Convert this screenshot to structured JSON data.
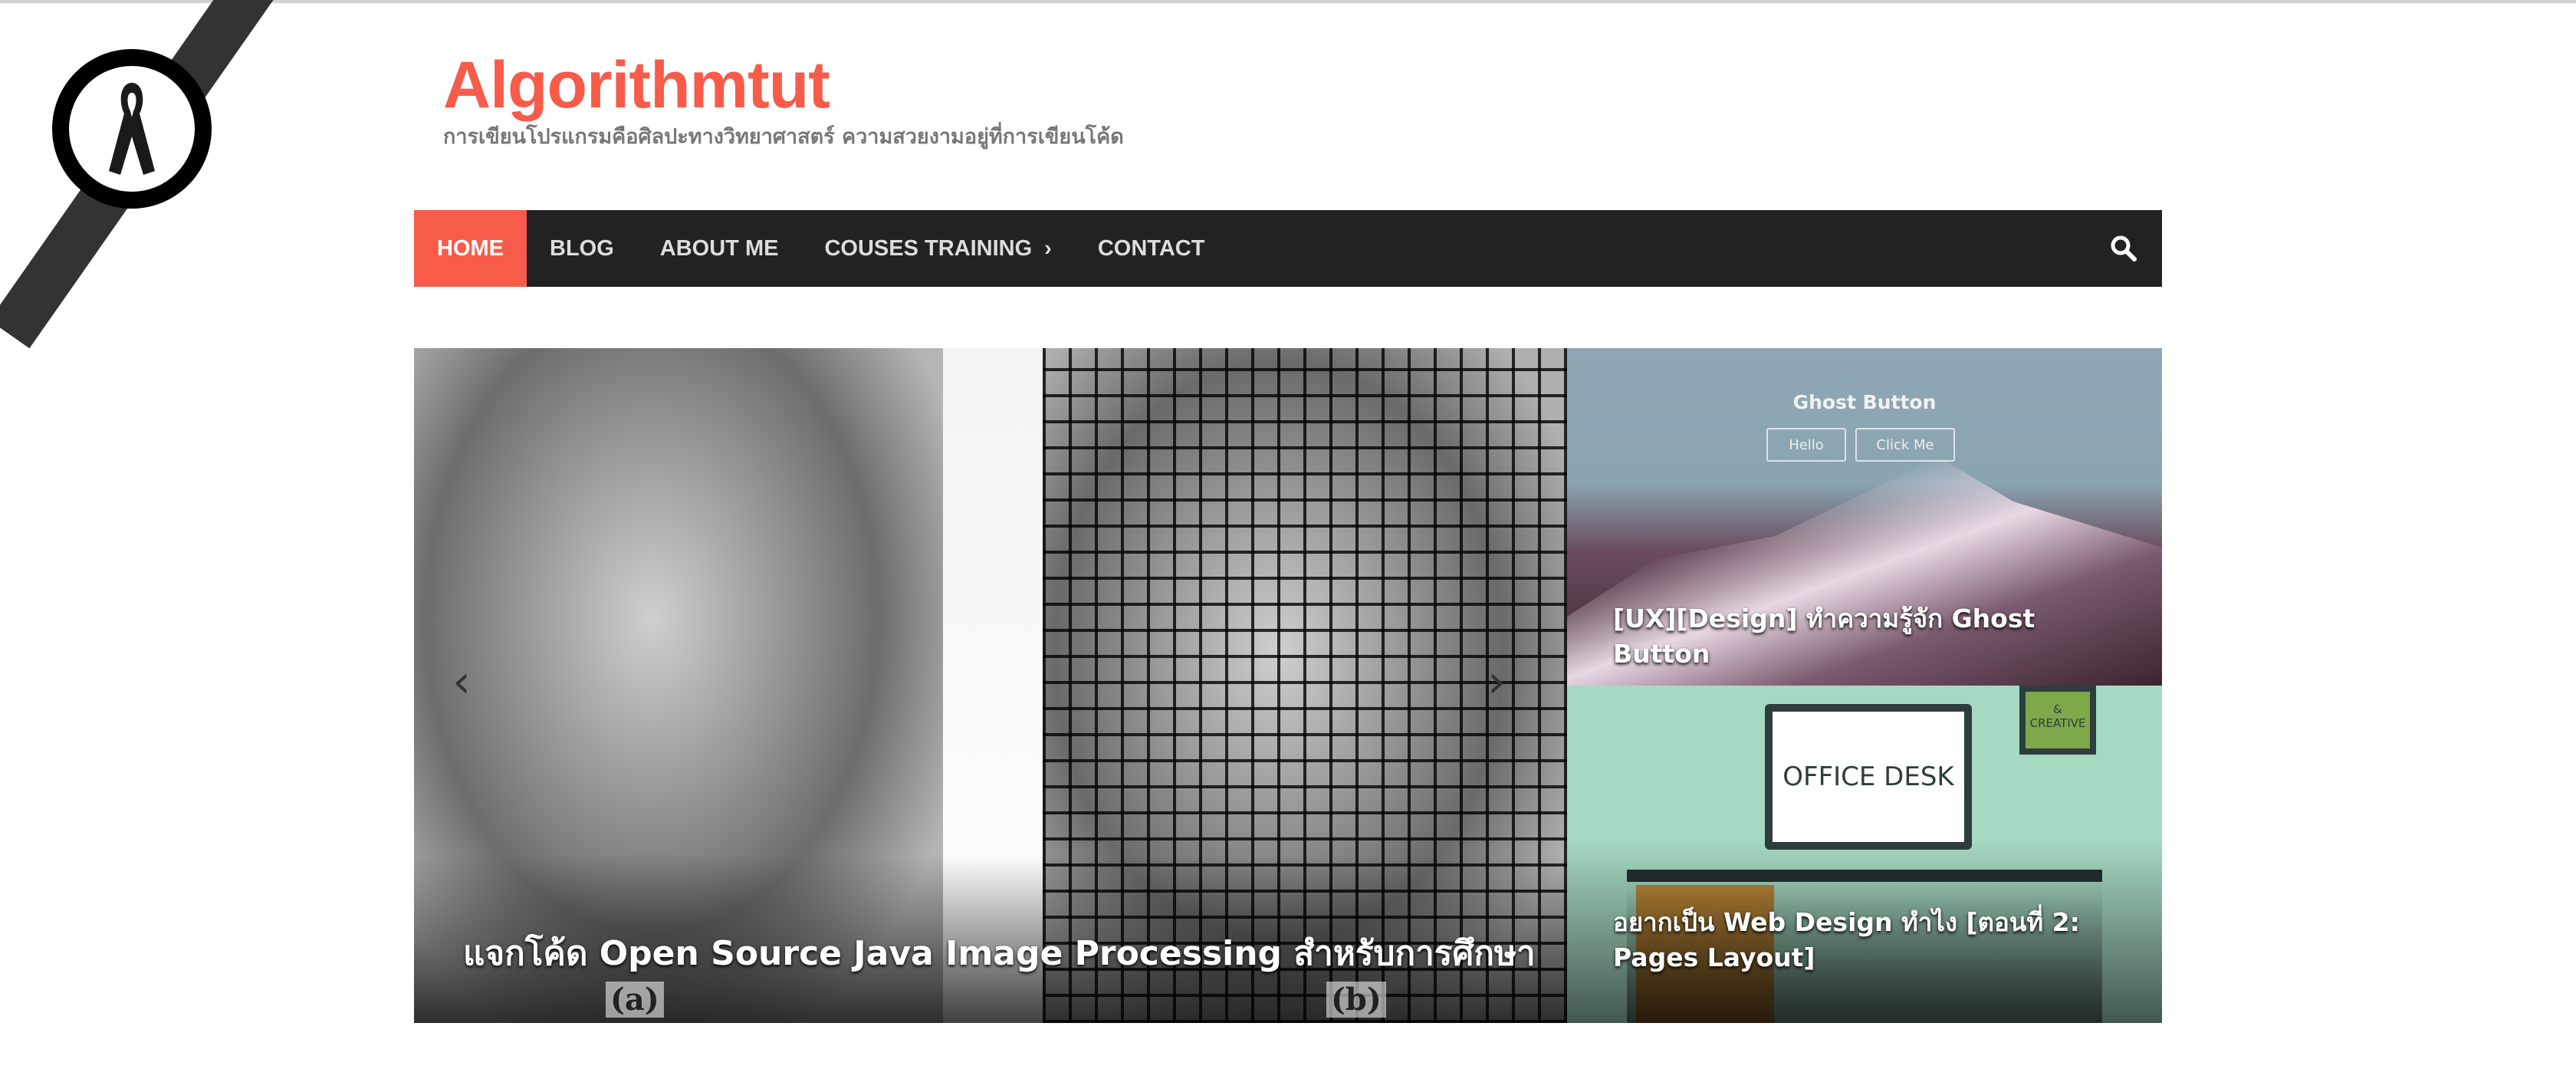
{
  "site": {
    "title": "Algorithmtut",
    "tagline": "การเขียนโปรแกรมคือศิลปะทางวิทยาศาสตร์ ความสวยงามอยู่ที่การเขียนโค้ด",
    "accent": "#f75b4a"
  },
  "nav": {
    "items": [
      {
        "label": "HOME",
        "active": true
      },
      {
        "label": "BLOG"
      },
      {
        "label": "ABOUT ME"
      },
      {
        "label": "COUSES TRAINING",
        "submenu": true
      },
      {
        "label": "CONTACT"
      }
    ],
    "search_icon": "search-icon"
  },
  "slider": {
    "caption": "แจกโค้ด Open Source Java Image Processing สำหรับการศึกษา",
    "label_a": "(a)",
    "label_b": "(b)",
    "prev": "‹",
    "next": "›"
  },
  "featured": [
    {
      "caption": "[UX][Design] ทำความรู้จัก Ghost Button",
      "image_title": "Ghost Button",
      "image_buttons": [
        "Hello",
        "Click Me"
      ]
    },
    {
      "caption": "อยากเป็น Web Design ทำไง [ตอนที่ 2: Pages Layout]",
      "image_text": "OFFICE DESK",
      "frame_text": "& CREATIVE"
    }
  ]
}
